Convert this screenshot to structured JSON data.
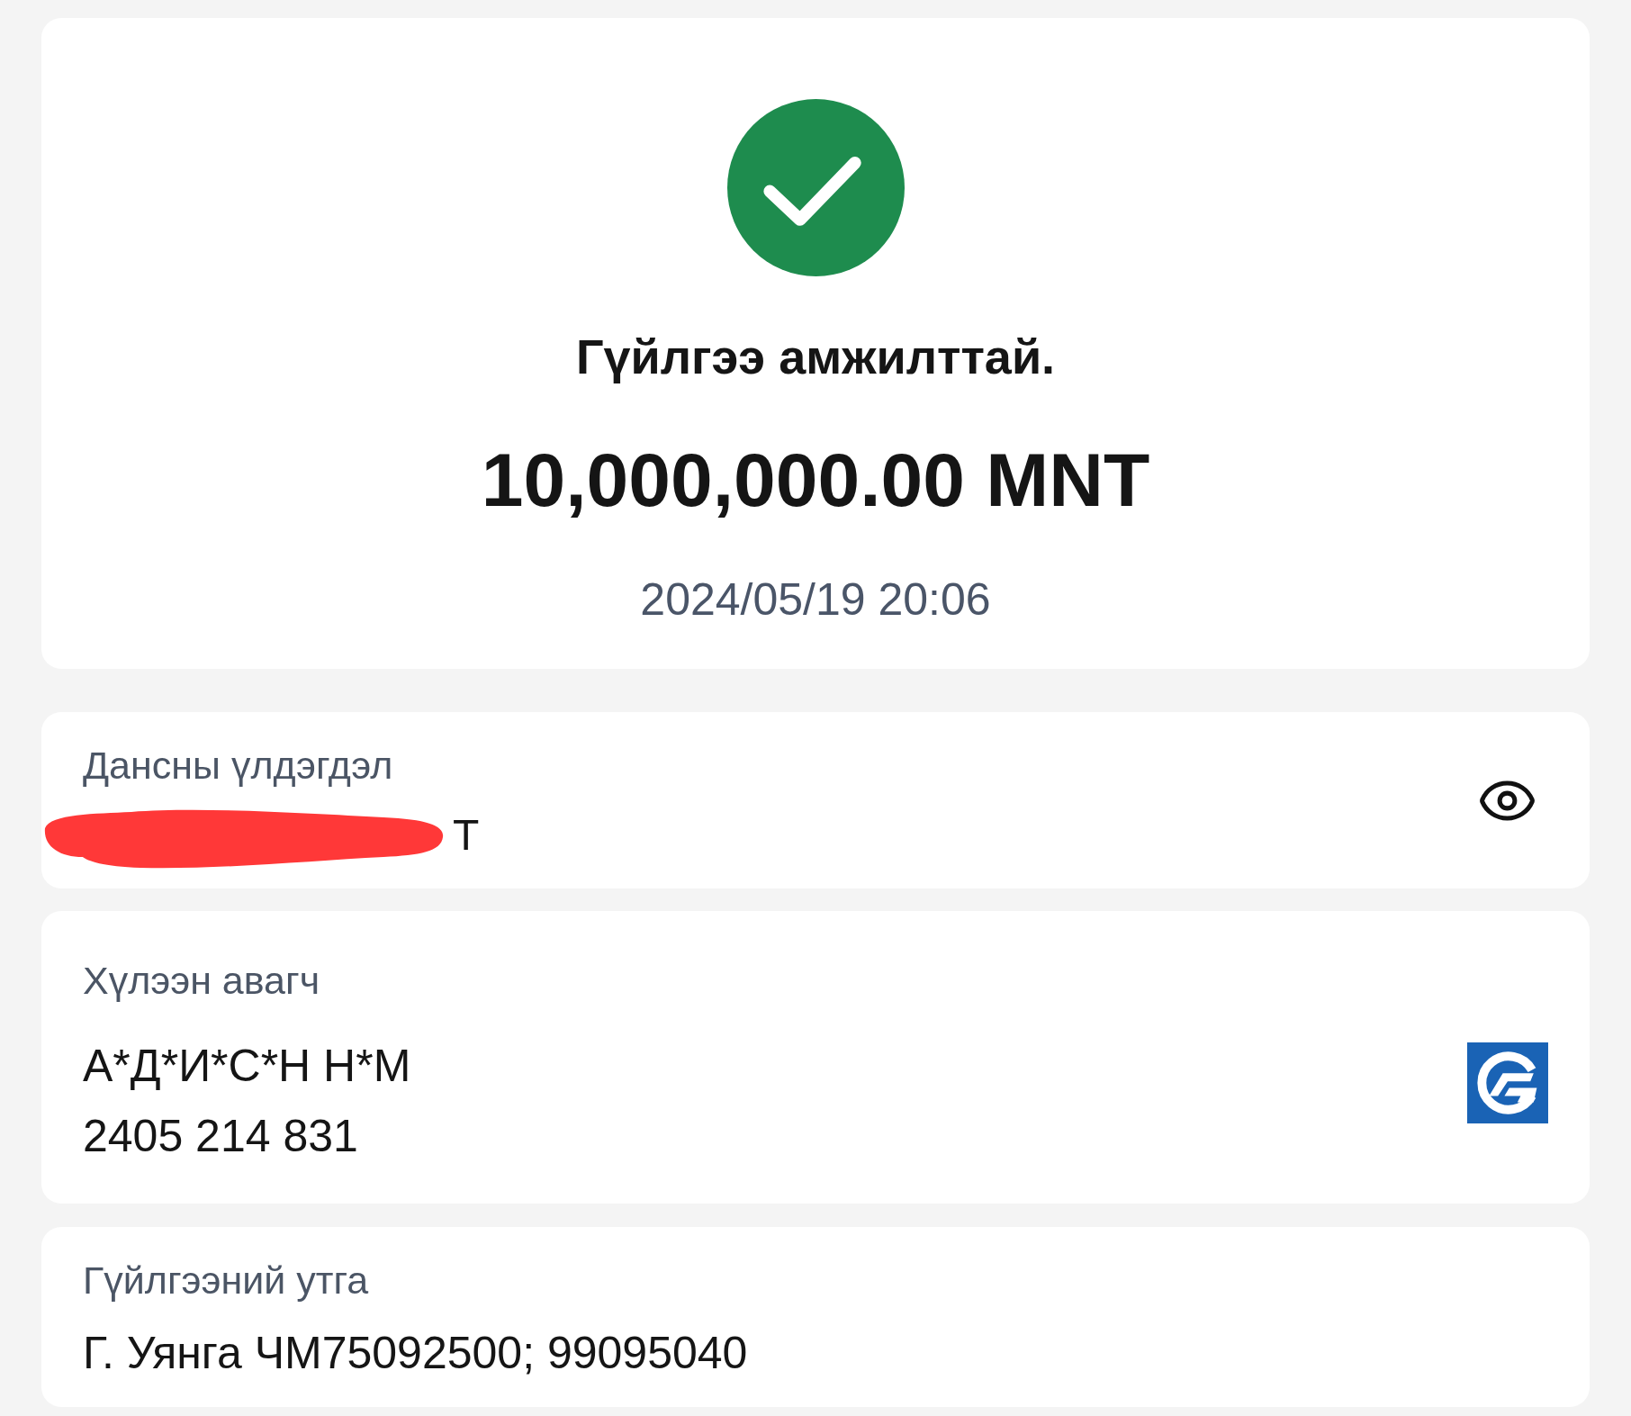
{
  "status": {
    "kind": "success",
    "title": "Гүйлгээ амжилттай."
  },
  "amount": "10,000,000.00 MNT",
  "datetime": "2024/05/19 20:06",
  "balance": {
    "label": "Дансны үлдэгдэл",
    "value": "T",
    "redacted": true
  },
  "recipient": {
    "label": "Хүлээн авагч",
    "name": "А*Д*И*С*Н Н*М",
    "account": "2405 214 831"
  },
  "description": {
    "label": "Гүйлгээний утга",
    "value": "Г. Уянга ЧМ75092500; 99095040"
  }
}
